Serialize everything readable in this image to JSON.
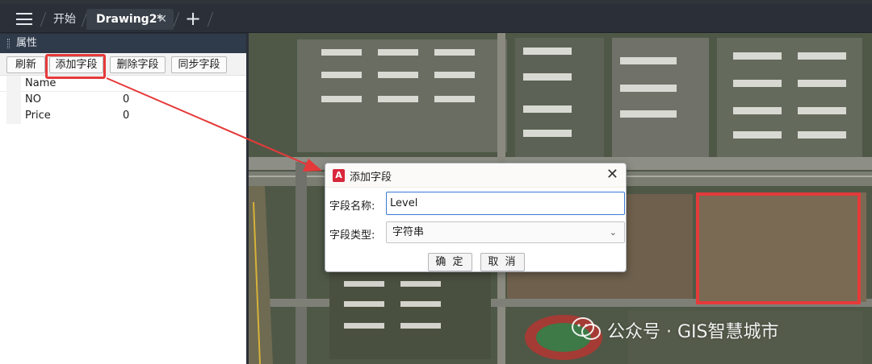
{
  "tabs": {
    "home_label": "开始",
    "drawing_label": "Drawing2*",
    "close_glyph": "✕",
    "add_glyph": "+"
  },
  "panel": {
    "title": "属性",
    "buttons": {
      "refresh": "刷新",
      "add_field": "添加字段",
      "delete_field": "删除字段",
      "sync_field": "同步字段"
    },
    "header": "Name",
    "rows": [
      {
        "name": "NO",
        "value": "0"
      },
      {
        "name": "Price",
        "value": "0"
      }
    ]
  },
  "dialog": {
    "logo": "A",
    "title": "添加字段",
    "close_glyph": "✕",
    "name_label": "字段名称:",
    "name_value": "Level",
    "type_label": "字段类型:",
    "type_value": "字符串",
    "chevron": "⌄",
    "ok": "确 定",
    "cancel": "取 消"
  },
  "watermark": "公众号 · GIS智慧城市",
  "colors": {
    "highlight": "#e53a3a",
    "accent": "#3b7bd3"
  }
}
